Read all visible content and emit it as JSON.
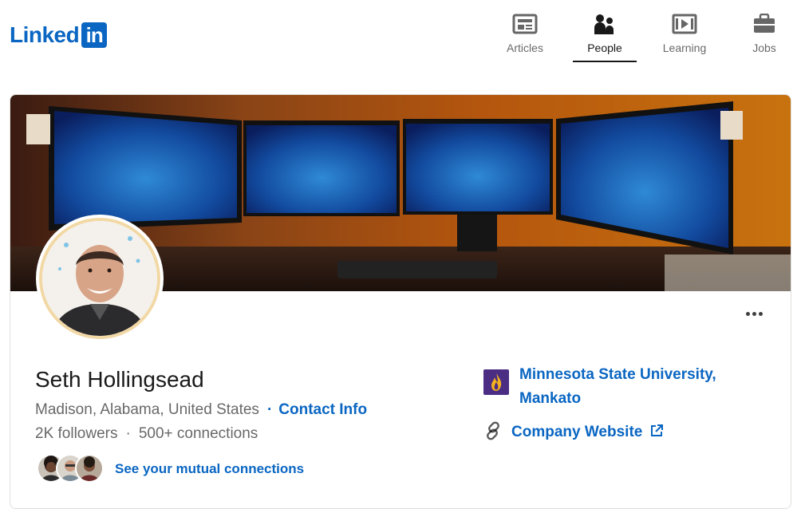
{
  "brand": {
    "logo_text": "Linked",
    "logo_box": "in",
    "color": "#0a66c2"
  },
  "nav": [
    {
      "label": "Articles",
      "icon": "articles-icon",
      "active": false
    },
    {
      "label": "People",
      "icon": "people-icon",
      "active": true
    },
    {
      "label": "Learning",
      "icon": "learning-icon",
      "active": false
    },
    {
      "label": "Jobs",
      "icon": "jobs-icon",
      "active": false
    }
  ],
  "profile": {
    "name": "Seth Hollingsead",
    "location": "Madison, Alabama, United States",
    "separator": "·",
    "contact_label": "Contact Info",
    "followers": "2K followers",
    "connections": "500+ connections",
    "mutual_label": "See your mutual connections"
  },
  "sidebar": {
    "school_name": "Minnesota State University, Mankato",
    "school_logo": "minnesota-state-flame-logo",
    "website_label": "Company Website"
  },
  "colors": {
    "link": "#0a66c2",
    "school_brand": "#4b2e83"
  }
}
